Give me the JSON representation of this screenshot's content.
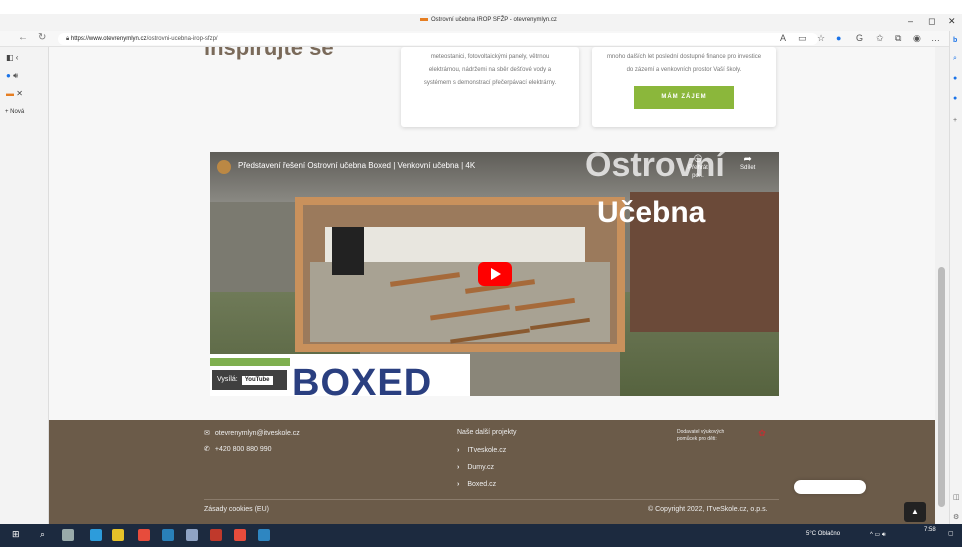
{
  "top_link": "",
  "window": {
    "title": "Ostrovní učebna IROP SFŽP - otevrenymlyn.cz",
    "controls": [
      "–",
      "◻",
      "✕"
    ]
  },
  "address_bar": {
    "url_host": "https://www.otevrenymlyn.cz",
    "url_path": "/ostrovni-ucebna-irop-sfzp/"
  },
  "sidebar": {
    "new_tab_label": "+ Nová"
  },
  "page": {
    "heading_partial": "inspirujte se",
    "card1_text": "meteostanici, fotovoltaickými panely, větrnou elektrárnou, nádržemi na sběr dešťové vody a systémem s demonstrací přečerpávací elektrárny.",
    "card2_text": "mnoho dalších let poslední dostupné finance pro investice do zázemí a venkovních prostor Vaší školy.",
    "cta_label": "MÁM ZÁJEM"
  },
  "video": {
    "title": "Představení řešení Ostrovní učebna Boxed | Venkovní učebna | 4K",
    "overlay_top": "Ostrovní",
    "overlay_main": "Učebna",
    "watch_later": "Přehrát po...",
    "share": "Sdílet",
    "broadcast_label": "Vysílá:",
    "youtube_label": "YouTube",
    "logo_text": "BOXED"
  },
  "footer": {
    "email": "otevrenymlyn@itveskole.cz",
    "phone": "+420 800 880 990",
    "projects_heading": "Naše další projekty",
    "projects": [
      "ITveskole.cz",
      "Dumy.cz",
      "Boxed.cz"
    ],
    "supplier_text": "Dodavatel výukových pomůcek pro děti:",
    "cookies": "Zásady cookies (EU)",
    "copyright": "© Copyright 2022, ITveSkole.cz, o.p.s."
  },
  "taskbar": {
    "weather": "5°C  Oblačno",
    "time": "7:58"
  }
}
